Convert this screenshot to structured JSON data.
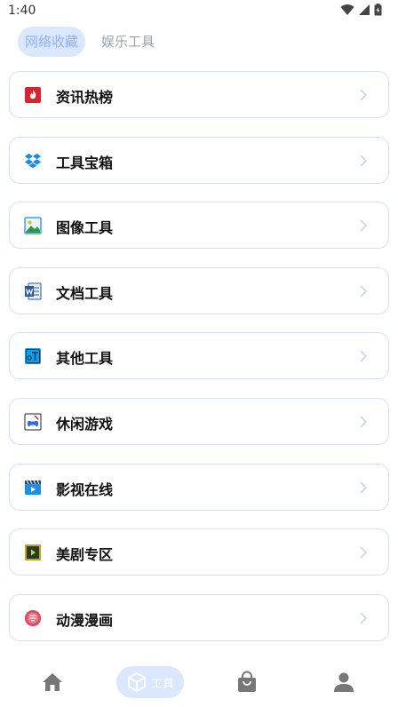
{
  "status": {
    "time": "1:40"
  },
  "tabs": [
    {
      "label": "网络收藏",
      "active": true
    },
    {
      "label": "娱乐工具",
      "active": false
    }
  ],
  "items": [
    {
      "label": "资讯热榜",
      "icon": "fire-news-icon",
      "color": "#d9232e"
    },
    {
      "label": "工具宝箱",
      "icon": "dropbox-icon",
      "color": "#1e88e5"
    },
    {
      "label": "图像工具",
      "icon": "image-icon",
      "color": "#3aa0e8"
    },
    {
      "label": "文档工具",
      "icon": "word-doc-icon",
      "color": "#2b579a"
    },
    {
      "label": "其他工具",
      "icon": "text-tool-icon",
      "color": "#1b9be0"
    },
    {
      "label": "休闲游戏",
      "icon": "gamepad-icon",
      "color": "#2d6de0"
    },
    {
      "label": "影视在线",
      "icon": "video-player-icon",
      "color": "#1f8fe0"
    },
    {
      "label": "美剧专区",
      "icon": "film-frame-icon",
      "color": "#c8a21a"
    },
    {
      "label": "动漫漫画",
      "icon": "manga-icon",
      "color": "#e04a5f"
    }
  ],
  "bottom_nav": {
    "tools_label": "工具",
    "accent": "#dbe7ff",
    "icon_color": "#777777"
  }
}
